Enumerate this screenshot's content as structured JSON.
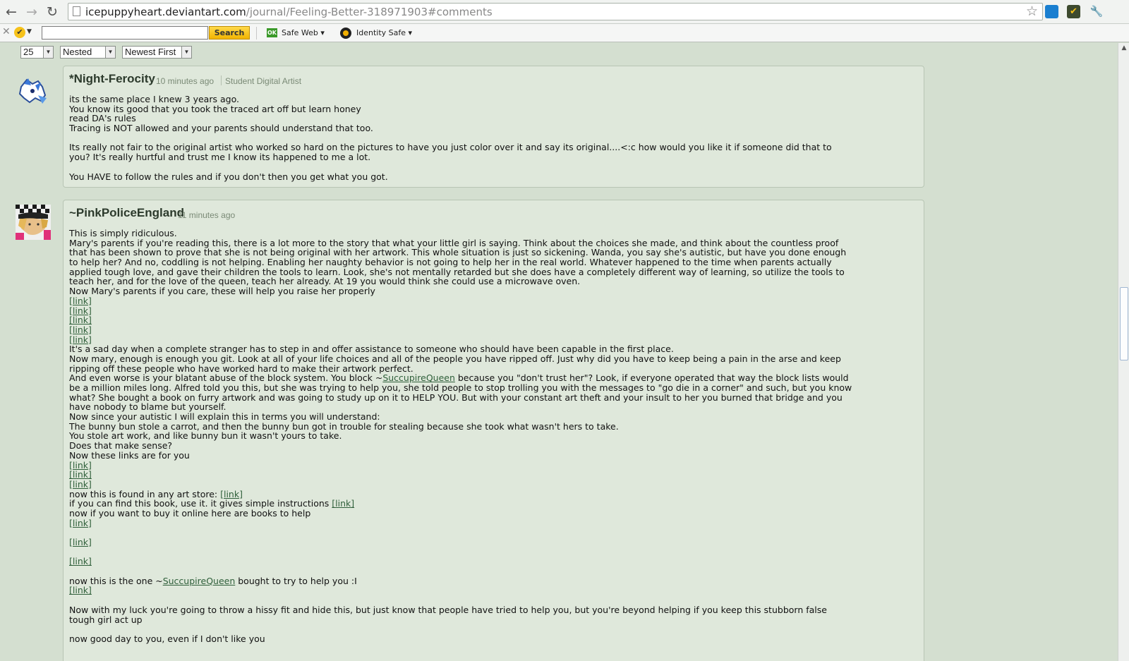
{
  "browser": {
    "back_glyph": "←",
    "forward_glyph": "→",
    "reload_glyph": "↻",
    "url_host": "icepuppyheart.deviantart.com",
    "url_path": "/journal/Feeling-Better-318971903#comments",
    "star_glyph": "☆",
    "wrench_glyph": "🔧"
  },
  "toolbar": {
    "close_glyph": "✕",
    "search_button": "Search",
    "safe_badge": "OK",
    "safe_web_label": "Safe Web ▾",
    "identity_safe_label": "Identity Safe ▾"
  },
  "controls": {
    "per_page": "25",
    "view_mode": "Nested",
    "sort_order": "Newest First",
    "arrow_glyph": "▼"
  },
  "comments": [
    {
      "username": "*Night-Ferocity",
      "time": "10 minutes ago",
      "role": "Student Digital Artist",
      "lines": [
        "its the same place I knew 3 years ago.",
        "You know its good that you took the traced art off but learn honey",
        "read DA's rules",
        "Tracing is NOT allowed and your parents should understand that too.",
        "",
        "Its really not fair to the original artist who worked so hard on the pictures to have you just color over it and say its original....<:c how would you like it if someone did that to",
        "you? It's really hurtful and trust me I know its happened to me a lot.",
        "",
        "You HAVE to follow the rules and if you don't then you get what you got."
      ]
    },
    {
      "username": "~PinkPoliceEngland",
      "time": "11 minutes ago",
      "lines": [
        "This is simply ridiculous.",
        "Mary's parents if you're reading this, there is a lot more to the story that what your little girl is saying. Think about the choices she made, and think about the countless proof",
        "that has been shown to prove that she is not being original with her artwork. This whole situation is just so sickening. Wanda, you say she's autistic, but have you done enough",
        "to help her? And no, coddling is not helping. Enabling her naughty behavior is not going to help her in the real world. Whatever happened to the time when parents actually",
        "applied tough love, and gave their children the tools to learn. Look, she's not mentally retarded but she does have a completely different way of learning, so utilize the tools to",
        "teach her, and for the love of the queen, teach her already. At 19 you would think she could use a microwave oven.",
        "Now Mary's parents if you care, these will help you raise her properly"
      ],
      "link_text": "[link]",
      "lines2": [
        "It's a sad day when a complete stranger has to step in and offer assistance to someone who should have been capable in the first place.",
        "Now mary, enough is enough you git. Look at all of your life choices and all of the people you have ripped off. Just why did you have to keep being a pain in the arse and keep",
        "ripping off these people who have worked hard to make their artwork perfect."
      ],
      "block_line_pre": "And even worse is your blatant abuse of the block system. You block ~",
      "mention": "SuccupireQueen",
      "block_line_post": " because you \"don't trust her\"? Look, if everyone operated that way the block lists would",
      "lines3": [
        "be a million miles long. Alfred told you this, but she was trying to help you, she told people to stop trolling you with the messages to \"go die in a corner\" and such, but you know",
        "what? She bought a book on furry artwork and was going to study up on it to HELP YOU. But with your constant art theft and your insult to her you burned that bridge and you",
        "have nobody to blame but yourself.",
        "Now since your autistic I will explain this in terms you will understand:",
        "The bunny bun stole a carrot, and then the bunny bun got in trouble for stealing because she took what wasn't hers to take.",
        "You stole art work, and like bunny bun it wasn't yours to take.",
        "Does that make sense?",
        "Now these links are for you"
      ],
      "art_store_line": "now this is found in any art store: ",
      "book_line": "if you can find this book, use it. it gives simple instructions ",
      "online_line": "now if you want to buy it online here are books to help",
      "bought_pre": "now this is the one ~",
      "bought_post": " bought to try to help you :I",
      "lines4": [
        "Now with my luck you're going to throw a hissy fit and hide this, but just know that people have tried to help you, but you're beyond helping if you keep this stubborn false",
        "tough girl act up"
      ],
      "closing": "now good day to you, even if I don't like you"
    }
  ]
}
